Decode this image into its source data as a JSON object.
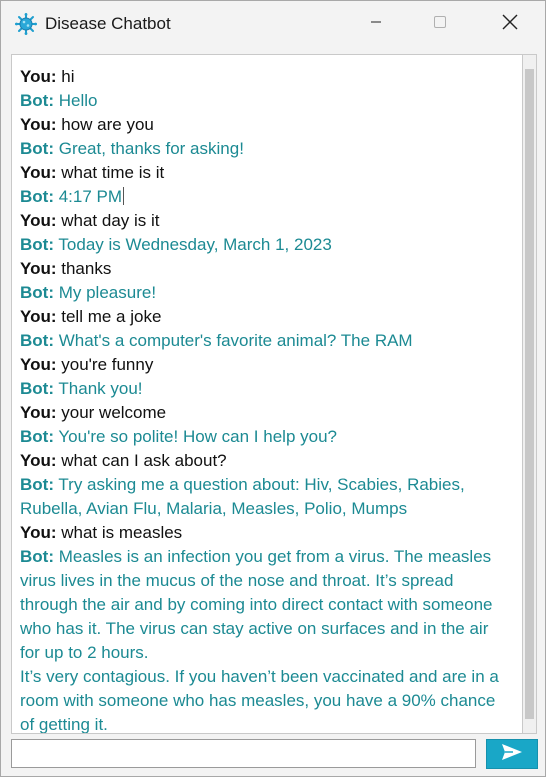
{
  "window": {
    "title": "Disease Chatbot",
    "app_icon": "virus-icon",
    "controls": [
      "minimize-icon",
      "maximize-icon",
      "close-icon"
    ]
  },
  "colors": {
    "user_text": "#111111",
    "bot_text": "#1c8a93",
    "send_button": "#19a7c7"
  },
  "chat": {
    "messages": [
      {
        "speaker": "You:",
        "text": "hi"
      },
      {
        "speaker": "Bot:",
        "text": "Hello"
      },
      {
        "speaker": "You:",
        "text": "how are you"
      },
      {
        "speaker": "Bot:",
        "text": "Great, thanks for asking!"
      },
      {
        "speaker": "You:",
        "text": "what time is it"
      },
      {
        "speaker": "Bot:",
        "text": "4:17 PM"
      },
      {
        "speaker": "You:",
        "text": "what day is it"
      },
      {
        "speaker": "Bot:",
        "text": "Today is Wednesday, March 1, 2023"
      },
      {
        "speaker": "You:",
        "text": "thanks"
      },
      {
        "speaker": "Bot:",
        "text": "My pleasure!"
      },
      {
        "speaker": "You:",
        "text": "tell me a joke"
      },
      {
        "speaker": "Bot:",
        "text": "What's a computer's favorite animal? The RAM"
      },
      {
        "speaker": "You:",
        "text": "you're funny"
      },
      {
        "speaker": "Bot:",
        "text": "Thank you!"
      },
      {
        "speaker": "You:",
        "text": "your welcome"
      },
      {
        "speaker": "Bot:",
        "text": "You're so polite! How can I help you?"
      },
      {
        "speaker": "You:",
        "text": "what can I ask about?"
      },
      {
        "speaker": "Bot:",
        "text": "Try asking me a question about: Hiv, Scabies, Rabies, Rubella, Avian Flu, Malaria, Measles, Polio, Mumps"
      },
      {
        "speaker": "You:",
        "text": "what is measles"
      },
      {
        "speaker": "Bot:",
        "text": "Measles is an infection you get from a virus. The measles virus lives in the mucus of the nose and throat. It’s spread through the air and by coming into direct contact with someone who has it. The virus can stay active on surfaces and in the air for up to 2 hours."
      },
      {
        "speaker": "",
        "text": "It’s very contagious. If you haven’t been vaccinated and are in a room with someone who has measles, you have a 90% chance of getting it."
      }
    ]
  },
  "input": {
    "value": "",
    "send_icon": "send-arrow-icon"
  }
}
